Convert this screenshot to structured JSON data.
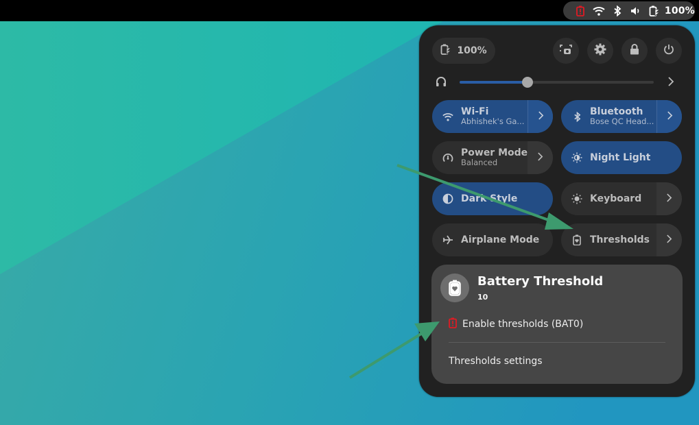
{
  "topbar": {
    "battery_percent": "100%",
    "icons": [
      "battery-alert-icon",
      "wifi-icon",
      "bluetooth-icon",
      "volume-icon",
      "battery-charging-icon"
    ]
  },
  "quick_settings": {
    "battery_label": "100%",
    "buttons": [
      "screenshot-icon",
      "settings-icon",
      "lock-icon",
      "power-icon"
    ],
    "volume": {
      "device_icon": "headphones-icon",
      "level_percent": 35
    },
    "tiles": [
      {
        "id": "wifi",
        "title": "Wi-Fi",
        "subtitle": "Abhishek's Ga...",
        "active": true,
        "has_menu": true,
        "icon": "wifi-icon"
      },
      {
        "id": "bluetooth",
        "title": "Bluetooth",
        "subtitle": "Bose QC Head...",
        "active": true,
        "has_menu": true,
        "icon": "bluetooth-icon"
      },
      {
        "id": "power-mode",
        "title": "Power Mode",
        "subtitle": "Balanced",
        "active": false,
        "has_menu": true,
        "icon": "power-mode-icon"
      },
      {
        "id": "night-light",
        "title": "Night Light",
        "subtitle": "",
        "active": true,
        "has_menu": false,
        "icon": "night-light-icon"
      },
      {
        "id": "dark-style",
        "title": "Dark Style",
        "subtitle": "",
        "active": true,
        "has_menu": false,
        "icon": "dark-style-icon"
      },
      {
        "id": "keyboard",
        "title": "Keyboard",
        "subtitle": "",
        "active": false,
        "has_menu": true,
        "icon": "brightness-icon"
      },
      {
        "id": "airplane-mode",
        "title": "Airplane Mode",
        "subtitle": "",
        "active": false,
        "has_menu": false,
        "icon": "airplane-icon"
      },
      {
        "id": "thresholds",
        "title": "Thresholds",
        "subtitle": "",
        "active": false,
        "has_menu": true,
        "icon": "battery-heart-icon"
      }
    ],
    "threshold_menu": {
      "title": "Battery Threshold",
      "subtitle": "10",
      "items": [
        {
          "label": "Enable thresholds (BAT0)",
          "icon": "battery-alert-icon"
        },
        {
          "label": "Thresholds settings"
        }
      ]
    }
  },
  "colors": {
    "accent": "#234d85",
    "alert": "#e01b24",
    "annotation_arrow": "#3d9a6e"
  }
}
